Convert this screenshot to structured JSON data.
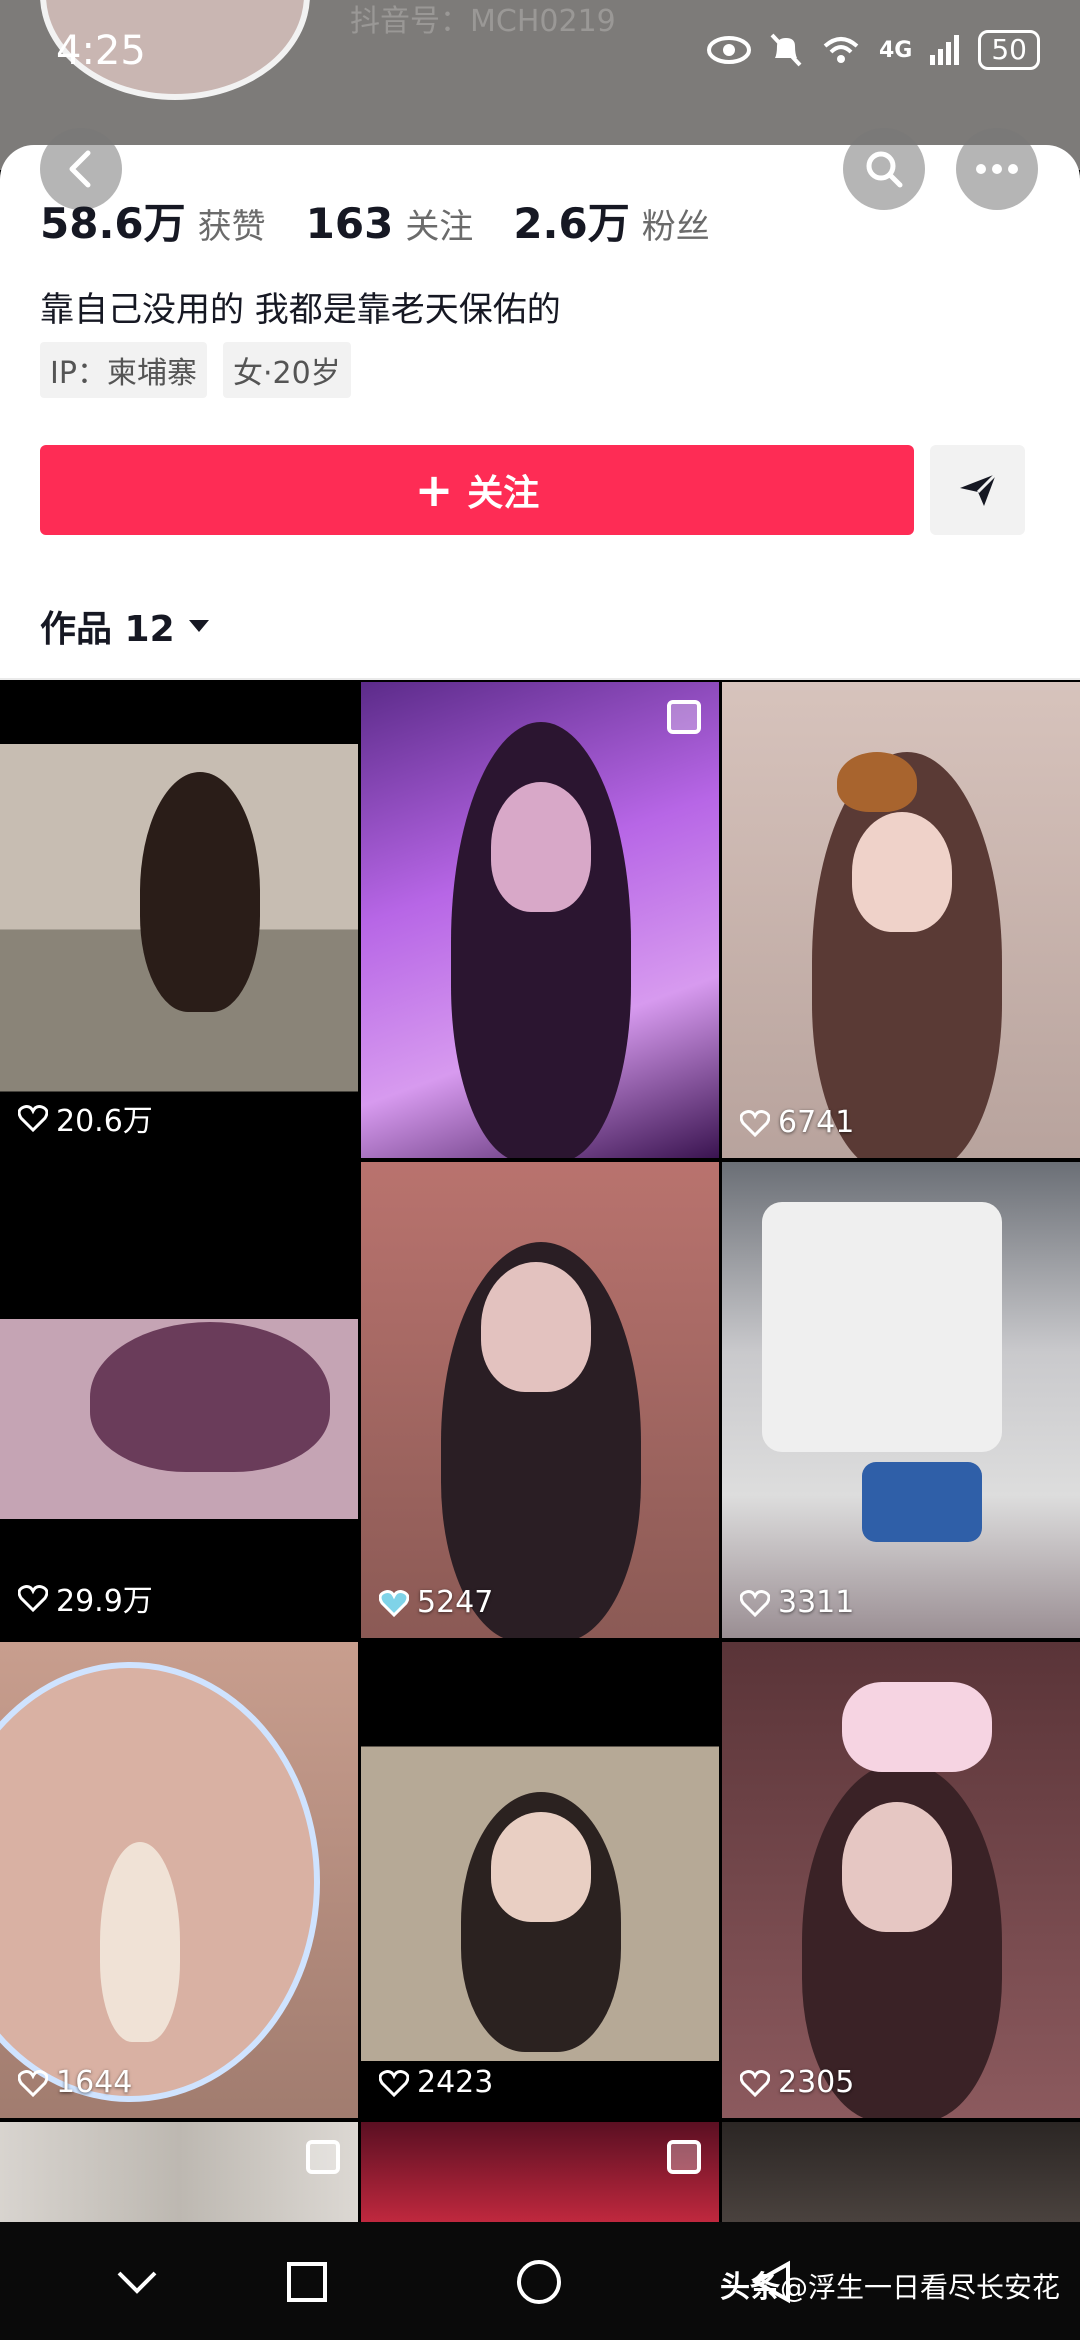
{
  "status_bar": {
    "time": "4:25",
    "battery": "50",
    "network": "4G"
  },
  "profile": {
    "douyin_id": "抖音号：MCH0219",
    "stats": [
      {
        "num": "58.6万",
        "label": "获赞"
      },
      {
        "num": "163",
        "label": "关注"
      },
      {
        "num": "2.6万",
        "label": "粉丝"
      }
    ],
    "bio": "靠自己没用的 我都是靠老天保佑的",
    "tags": [
      "IP：柬埔寨",
      "女·20岁"
    ],
    "follow_label": "关注"
  },
  "works_tab": {
    "label": "作品 12"
  },
  "videos": [
    {
      "likes": "20.6万"
    },
    {
      "likes": ""
    },
    {
      "likes": "6741"
    },
    {
      "likes": "29.9万"
    },
    {
      "likes": "5247"
    },
    {
      "likes": "3311"
    },
    {
      "likes": "1644"
    },
    {
      "likes": "2423"
    },
    {
      "likes": "2305"
    }
  ],
  "watermark": {
    "brand": "头条",
    "author": "@浮生一日看尽长安花"
  },
  "colors": {
    "accent": "#fe2c55",
    "text": "#161823"
  },
  "icons": [
    "back-icon",
    "search-icon",
    "more-icon",
    "send-icon",
    "heart-icon",
    "multi-image-icon"
  ]
}
